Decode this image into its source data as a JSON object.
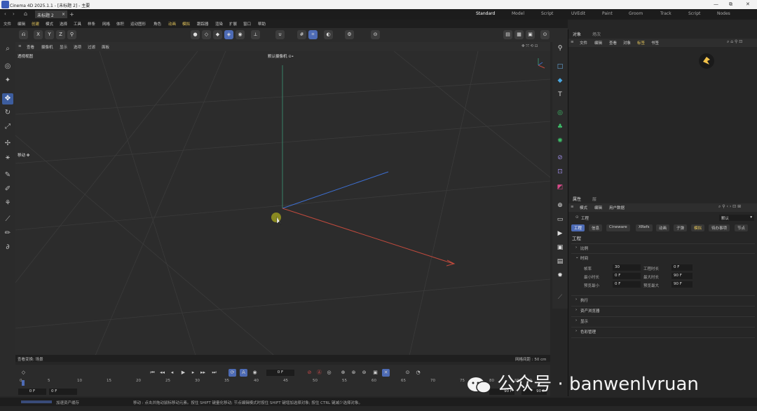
{
  "window": {
    "title": "Cinema 4D 2025.1.1 - [未标题 2] - 主要",
    "controls": [
      "—",
      "⧉",
      "✕"
    ]
  },
  "tabs": {
    "doc": "未标题 2",
    "close": "×",
    "add": "+"
  },
  "workspaces": [
    "Standard",
    "Model",
    "Script",
    "UVEdit",
    "Paint",
    "Groom",
    "Track",
    "Script",
    "Nodes"
  ],
  "menu": [
    "文件",
    "编辑",
    "创建",
    "模式",
    "选择",
    "工具",
    "样条",
    "网格",
    "体积",
    "运动图形",
    "角色",
    "动画",
    "模拟",
    "跟踪器",
    "渲染",
    "扩展",
    "窗口",
    "帮助"
  ],
  "toolbar": {
    "axes": [
      "X",
      "Y",
      "Z"
    ]
  },
  "viewport": {
    "menu": [
      "查看",
      "摄像机",
      "显示",
      "选项",
      "过滤",
      "面板"
    ],
    "name": "透视视图",
    "camera": "默认摄像机 ⊙•",
    "move_label": "移动 ✥",
    "status_left": "查看变换: 场景",
    "status_right": "网格间距 : 50 cm"
  },
  "objects_panel": {
    "tabs": [
      "对象",
      "场次"
    ],
    "menu": [
      "文件",
      "编辑",
      "查看",
      "对象",
      "标签",
      "书签"
    ]
  },
  "attributes_panel": {
    "tabs": [
      "属性",
      "层"
    ],
    "menu": [
      "模式",
      "编辑",
      "用户数据"
    ],
    "mode": "工程",
    "preset": "默认",
    "subtabs": [
      "工程",
      "信息",
      "Cineware",
      "XRefs",
      "动画",
      "子弹",
      "模拟",
      "待办事项",
      "节点"
    ],
    "section_title": "工程",
    "groups": [
      "比例",
      "时间",
      "执行",
      "资产浏览器",
      "显示",
      "色彩管理"
    ],
    "time": {
      "fps_label": "帧率",
      "fps": "30",
      "proj_len_label": "工程时长",
      "proj_len": "0 F",
      "min_label": "最小时长",
      "min": "0 F",
      "max_label": "最大时长",
      "max": "90 F",
      "pmin_label": "预览最小",
      "pmin": "0 F",
      "pmax_label": "预览最大",
      "pmax": "90 F"
    }
  },
  "timeline": {
    "current": "0 F",
    "ticks": [
      "0",
      "5",
      "10",
      "15",
      "20",
      "25",
      "30",
      "35",
      "40",
      "45",
      "50",
      "55",
      "60",
      "65",
      "70",
      "75",
      "80",
      "85",
      "90"
    ],
    "start": "0 F",
    "end_a": "90 F",
    "end_b": "90 F",
    "field_start": "0 F",
    "field_b": "0 F"
  },
  "statusbar": {
    "progress_label": "加速资产缓存",
    "hint": "移动 : 点击并拖动鼠标移动元素。按住 SHIFT 键量化移动; 节点编辑模式时按住 SHIFT 键增加选择对象; 按住 CTRL 键减少选择对象。"
  },
  "watermark": "公众号 · banwenlvruan",
  "colors": {
    "accent": "#4d6bb5",
    "highlight": "#e0c25a"
  }
}
